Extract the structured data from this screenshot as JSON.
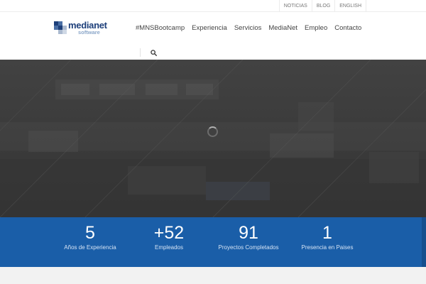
{
  "topbar": {
    "links": [
      "NOTICIAS",
      "BLOG",
      "ENGLISH"
    ]
  },
  "brand": {
    "name": "medianet",
    "sub": "software"
  },
  "nav": {
    "items": [
      "#MNSBootcamp",
      "Experiencia",
      "Servicios",
      "MediaNet",
      "Empleo",
      "Contacto"
    ]
  },
  "stats": [
    {
      "value": "5",
      "label": "Años de Experiencia"
    },
    {
      "value": "+52",
      "label": "Empleados"
    },
    {
      "value": "91",
      "label": "Proyectos Completados"
    },
    {
      "value": "1",
      "label": "Presencia en Paises"
    }
  ],
  "colors": {
    "stats_band": "#1a5ea8",
    "brand_dark": "#1d3f7a",
    "brand_light": "#8aa6c9",
    "hero_overlay": "#3c3c3c"
  },
  "icons": {
    "search": "search-icon",
    "loader": "loading-spinner-icon"
  }
}
